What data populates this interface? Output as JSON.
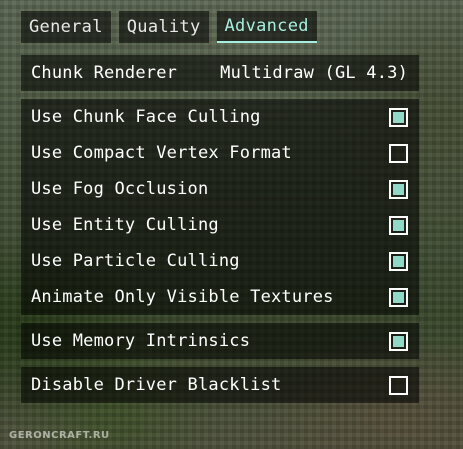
{
  "tabs": [
    {
      "label": "General",
      "active": false
    },
    {
      "label": "Quality",
      "active": false
    },
    {
      "label": "Advanced",
      "active": true
    }
  ],
  "renderer": {
    "label": "Chunk Renderer",
    "value": "Multidraw (GL 4.3)"
  },
  "options": [
    {
      "label": "Use Chunk Face Culling",
      "checked": true
    },
    {
      "label": "Use Compact Vertex Format",
      "checked": false
    },
    {
      "label": "Use Fog Occlusion",
      "checked": true
    },
    {
      "label": "Use Entity Culling",
      "checked": true
    },
    {
      "label": "Use Particle Culling",
      "checked": true
    },
    {
      "label": "Animate Only Visible Textures",
      "checked": true
    },
    {
      "label": "Use Memory Intrinsics",
      "checked": true
    },
    {
      "label": "Disable Driver Blacklist",
      "checked": false
    }
  ],
  "watermark": "GERONCRAFT.RU",
  "colors": {
    "accent": "#a6efe0",
    "checkbox_fill": "#8fd9c6",
    "panel_bg": "rgba(0,0,0,0.55)"
  }
}
